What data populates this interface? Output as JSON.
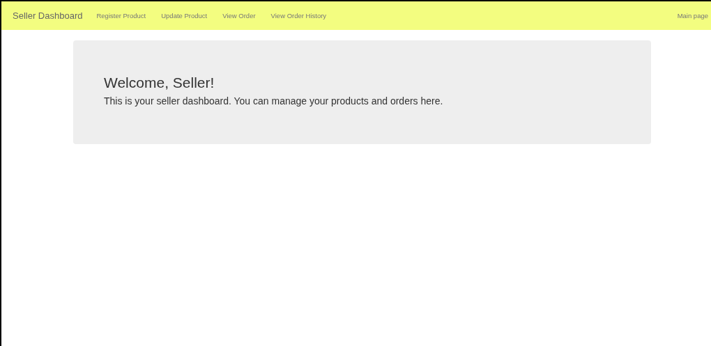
{
  "navbar": {
    "brand": "Seller Dashboard",
    "links": [
      {
        "label": "Register Product"
      },
      {
        "label": "Update Product"
      },
      {
        "label": "View Order"
      },
      {
        "label": "View Order History"
      }
    ],
    "right_link": "Main page"
  },
  "welcome": {
    "title": "Welcome, Seller!",
    "text": "This is your seller dashboard. You can manage your products and orders here."
  }
}
